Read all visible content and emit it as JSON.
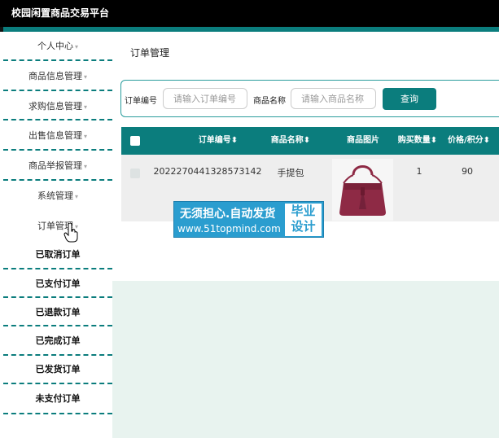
{
  "app": {
    "title": "校园闲置商品交易平台"
  },
  "sidebar": {
    "items": [
      {
        "label": "个人中心",
        "caret": "▾"
      },
      {
        "label": "商品信息管理",
        "caret": "▾"
      },
      {
        "label": "求购信息管理",
        "caret": "▾"
      },
      {
        "label": "出售信息管理",
        "caret": "▾"
      },
      {
        "label": "商品举报管理",
        "caret": "▾"
      },
      {
        "label": "系统管理",
        "caret": "▾"
      },
      {
        "label": "订单管理",
        "caret": "▾"
      },
      {
        "label": "已取消订单"
      },
      {
        "label": "已支付订单"
      },
      {
        "label": "已退款订单"
      },
      {
        "label": "已完成订单"
      },
      {
        "label": "已发货订单"
      },
      {
        "label": "未支付订单"
      }
    ]
  },
  "main": {
    "title": "订单管理",
    "search": {
      "order_no_label": "订单编号",
      "order_no_placeholder": "请输入订单编号",
      "goods_name_label": "商品名称",
      "goods_name_placeholder": "请输入商品名称",
      "button_label": "查询"
    },
    "table": {
      "headers": [
        "订单编号",
        "商品名称",
        "商品图片",
        "购买数量",
        "价格/积分"
      ],
      "rows": [
        {
          "order_no": "2022270441328573142",
          "goods_name": "手提包",
          "quantity": "1",
          "price": "90"
        }
      ]
    }
  },
  "watermark": {
    "line1": "无须担心.自动发货",
    "line2": "www.51topmind.com",
    "box_line1": "毕业",
    "box_line2": "设计"
  },
  "colors": {
    "accent": "#0b7d7d",
    "topbar": "#000000",
    "content_bg": "#e8f3ef",
    "watermark_bg": "#2a9dcf",
    "bag": "#8e2a45"
  },
  "icons": {
    "sort": "sort-icon",
    "cursor": "hand-pointer-icon"
  }
}
